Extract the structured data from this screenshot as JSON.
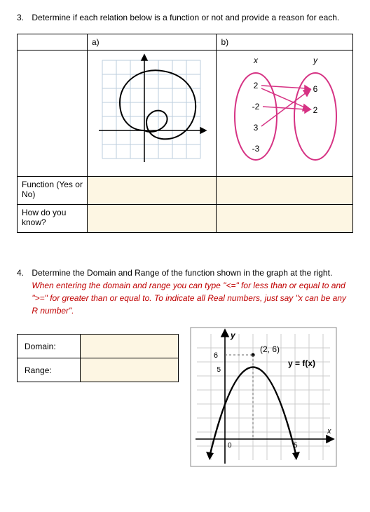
{
  "q3": {
    "number": "3.",
    "prompt": "Determine if each relation below is a function or not and provide a reason for each.",
    "parts": {
      "a": "a)",
      "b": "b)"
    },
    "rows": {
      "function_label": "Function (Yes or No)",
      "how_label": "How do you know?"
    },
    "mapping": {
      "x_label": "x",
      "y_label": "y",
      "x_values": [
        "2",
        "-2",
        "3",
        "-3"
      ],
      "y_values": [
        "6",
        "2"
      ],
      "pairs": [
        [
          0,
          0
        ],
        [
          0,
          1
        ],
        [
          1,
          1
        ],
        [
          2,
          0
        ]
      ]
    }
  },
  "q4": {
    "number": "4.",
    "prompt": "Determine the Domain and Range of the function shown in the graph at the right.",
    "instruction": "When entering the domain and range you can type \"<=\" for less than or equal to and \">=\" for greater than or equal to. To indicate all Real numbers, just say \"x can be any R number\".",
    "labels": {
      "domain": "Domain:",
      "range": "Range:"
    },
    "graph": {
      "y_axis_label": "y",
      "x_axis_label": "x",
      "vertex_label": "(2, 6)",
      "y_label_6": "6",
      "y_label_5": "5",
      "x_label_5": "5",
      "x_label_0": "0",
      "func_label": "y = f(x)"
    },
    "chart_data": {
      "type": "line",
      "title": "Downward parabola y = f(x)",
      "func_label": "y = f(x)",
      "vertex": {
        "x": 2,
        "y": 6
      },
      "xlim": [
        -2,
        7
      ],
      "ylim": [
        -3,
        8
      ],
      "x": [
        -1,
        0,
        1,
        2,
        3,
        4,
        5
      ],
      "y": [
        0,
        3.33,
        5.33,
        6,
        5.33,
        3.33,
        0
      ],
      "annotations": [
        {
          "text": "(2, 6)",
          "x": 2,
          "y": 6
        }
      ]
    }
  }
}
